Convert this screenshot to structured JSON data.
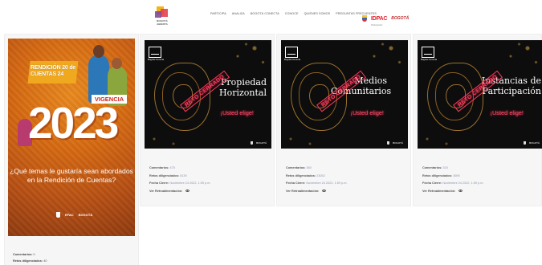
{
  "header": {
    "logo_text": "BOGOTÁ ABIERTA",
    "nav": [
      "PARTICIPA",
      "ANALIZA",
      "BOGOTÁ CONECTA",
      "CONOCE",
      "QUIENES SOMOS",
      "PREGUNTAS FRECUENTES"
    ],
    "partners": {
      "idpac": "IDPAC",
      "idpac_sub": "Participación",
      "bogota": "BOGOTÁ"
    }
  },
  "poster": {
    "top_text": "RENDICIÓN 20 de CUENTAS 24",
    "vigencia": "VIGENCIA",
    "year": "2023",
    "question": "¿Qué temas le gustaría sean abordados en la Rendición de Cuentas?",
    "footer": [
      "EFAC",
      "BOGOTÁ"
    ],
    "comments_label": "Comentarios:",
    "comments_value": "0",
    "retos_label": "Retos diligenciados:",
    "retos_value": "40"
  },
  "cards": [
    {
      "badge": "Bogotá Conecta",
      "stamp": "RETO CERRADO",
      "title": "Propiedad Horizontal",
      "subtitle": "¡Usted elige!",
      "comments_label": "Comentarios:",
      "comments_value": "475",
      "retos_label": "Retos diligenciados:",
      "retos_value": "8139",
      "fecha_label": "Fecha Cierre:",
      "fecha_value": "Noviembre 24 2022, 1:59 p.m.",
      "ver_label": "Ver Retroalimentación:"
    },
    {
      "badge": "Bogotá Conecta",
      "stamp": "RETO CERRADO",
      "title": "Medios Comunitarios",
      "subtitle": "¡Usted elige!",
      "comments_label": "Comentarios:",
      "comments_value": "360",
      "retos_label": "Retos diligenciados:",
      "retos_value": "23052",
      "fecha_label": "Fecha Cierre:",
      "fecha_value": "Noviembre 24 2022, 1:59 p.m.",
      "ver_label": "Ver Retroalimentación:"
    },
    {
      "badge": "Bogotá Conecta",
      "stamp": "RETO CERRADO",
      "title": "Instancias de Participación",
      "subtitle": "¡Usted elige!",
      "comments_label": "Comentarios:",
      "comments_value": "315",
      "retos_label": "Retos diligenciados:",
      "retos_value": "3695",
      "fecha_label": "Fecha Cierre:",
      "fecha_value": "Noviembre 24 2022, 1:59 p.m.",
      "ver_label": "Ver Retroalimentación:"
    }
  ],
  "colors": {
    "accent": "#e0242f",
    "poster_orange": "#d66a12",
    "stamp_red": "#ff3a5e"
  }
}
